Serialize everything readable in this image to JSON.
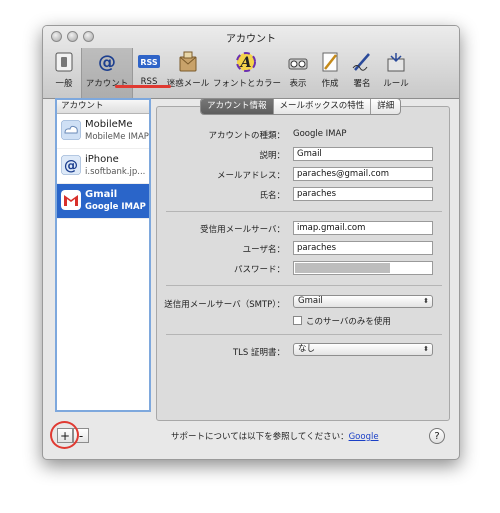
{
  "window": {
    "title": "アカウント"
  },
  "toolbar": {
    "items": [
      {
        "label": "一般",
        "icon": "general-switch-icon"
      },
      {
        "label": "アカウント",
        "icon": "at-sign-icon"
      },
      {
        "label": "RSS",
        "icon": "rss-icon"
      },
      {
        "label": "迷惑メール",
        "icon": "junk-mail-icon"
      },
      {
        "label": "フォントとカラー",
        "icon": "font-color-icon"
      },
      {
        "label": "表示",
        "icon": "view-icon"
      },
      {
        "label": "作成",
        "icon": "compose-icon"
      },
      {
        "label": "署名",
        "icon": "signature-icon"
      },
      {
        "label": "ルール",
        "icon": "rules-icon"
      }
    ],
    "selected": "アカウント"
  },
  "sidebar": {
    "header": "アカウント",
    "accounts": [
      {
        "name": "MobileMe",
        "sub": "MobileMe IMAP",
        "icon": "mobileme-icon"
      },
      {
        "name": "iPhone",
        "sub": "i.softbank.jp...",
        "icon": "at-mail-icon"
      },
      {
        "name": "Gmail",
        "sub": "Google IMAP",
        "icon": "gmail-icon"
      }
    ],
    "add_label": "+",
    "remove_label": "-"
  },
  "tabs": [
    "アカウント情報",
    "メールボックスの特性",
    "詳細"
  ],
  "form": {
    "account_type_label": "アカウントの種類：",
    "account_type_value": "Google IMAP",
    "description_label": "説明：",
    "description_value": "Gmail",
    "email_label": "メールアドレス：",
    "email_value": "paraches@gmail.com",
    "fullname_label": "氏名：",
    "fullname_value": "paraches",
    "incoming_server_label": "受信用メールサーバ：",
    "incoming_server_value": "imap.gmail.com",
    "username_label": "ユーザ名：",
    "username_value": "paraches",
    "password_label": "パスワード：",
    "smtp_label": "送信用メールサーバ（SMTP）：",
    "smtp_value": "Gmail",
    "only_this_server_label": "このサーバのみを使用",
    "tls_label": "TLS 証明書：",
    "tls_value": "なし"
  },
  "footer": {
    "support_text": "サポートについては以下を参照してください：",
    "support_link": "Google",
    "help_label": "?"
  },
  "colors": {
    "accent_underline": "#e03a32",
    "selection": "#2a65c9"
  }
}
